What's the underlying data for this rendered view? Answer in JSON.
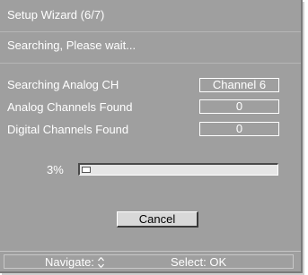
{
  "dialog": {
    "title": "Setup Wizard (6/7)",
    "status": "Searching, Please wait...",
    "rows": [
      {
        "label": "Searching Analog CH",
        "value": "Channel 6"
      },
      {
        "label": "Analog Channels Found",
        "value": "0"
      },
      {
        "label": "Digital Channels Found",
        "value": "0"
      }
    ],
    "progress": {
      "label": "3%",
      "fraction": 0.03
    },
    "cancel_label": "Cancel"
  },
  "footer": {
    "navigate_label": "Navigate:",
    "navigate_icon": "up-down-arrow-icon",
    "select_label": "Select: OK"
  }
}
